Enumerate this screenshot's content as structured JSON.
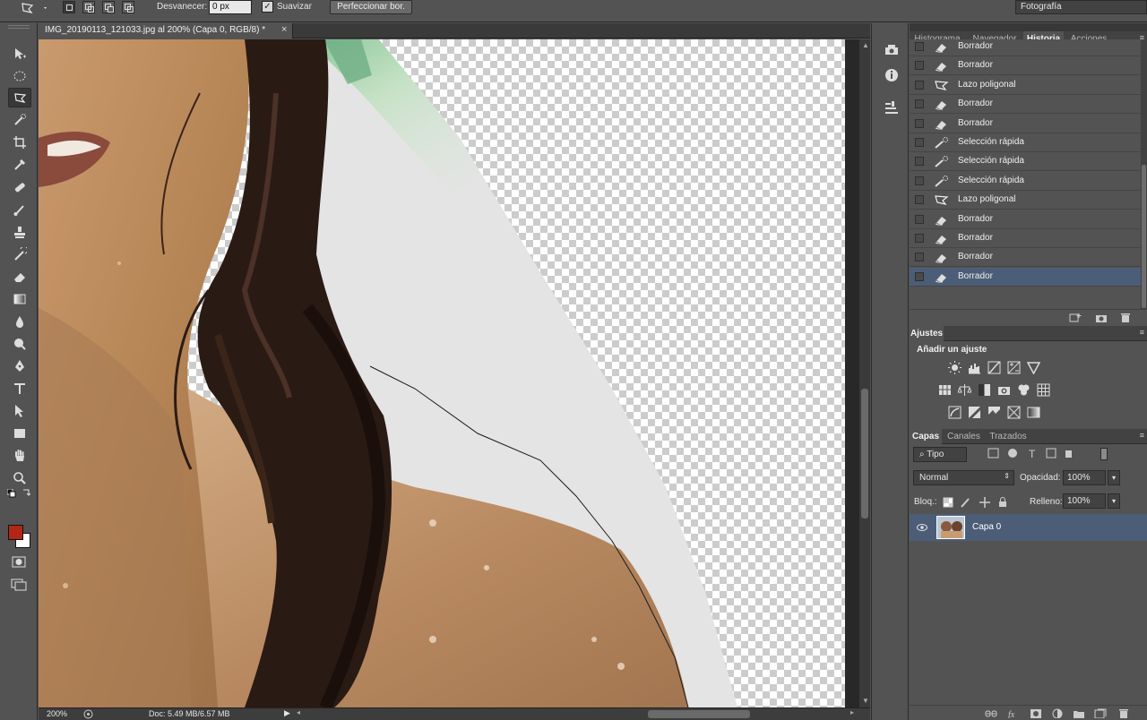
{
  "options_bar": {
    "feather_label": "Desvanecer:",
    "feather_value": "0 px",
    "antialias_label": "Suavizar",
    "antialias_checked": true,
    "refine_edge_label": "Perfeccionar bor.",
    "workspace": "Fotografía"
  },
  "toolbar": {
    "active_tool": "polygonal-lasso",
    "foreground_color": "#b22616",
    "background_color": "#ffffff"
  },
  "document": {
    "tab_title": "IMG_20190113_121033.jpg al 200% (Capa 0, RGB/8) *",
    "close_glyph": "×"
  },
  "status": {
    "zoom": "200%",
    "doc_size": "Doc: 5.49 MB/6.57 MB"
  },
  "history_panel": {
    "tabs": [
      "Histograma",
      "Navegador",
      "Historia",
      "Acciones"
    ],
    "active_tab": "Historia",
    "items": [
      {
        "label": "Borrador",
        "icon": "eraser-icon"
      },
      {
        "label": "Borrador",
        "icon": "eraser-icon"
      },
      {
        "label": "Lazo poligonal",
        "icon": "polygonal-lasso-icon"
      },
      {
        "label": "Borrador",
        "icon": "eraser-icon"
      },
      {
        "label": "Borrador",
        "icon": "eraser-icon"
      },
      {
        "label": "Selección rápida",
        "icon": "quick-selection-icon"
      },
      {
        "label": "Selección rápida",
        "icon": "quick-selection-icon"
      },
      {
        "label": "Selección rápida",
        "icon": "quick-selection-icon"
      },
      {
        "label": "Lazo poligonal",
        "icon": "polygonal-lasso-icon"
      },
      {
        "label": "Borrador",
        "icon": "eraser-icon"
      },
      {
        "label": "Borrador",
        "icon": "eraser-icon"
      },
      {
        "label": "Borrador",
        "icon": "eraser-icon"
      },
      {
        "label": "Borrador",
        "icon": "eraser-icon"
      }
    ],
    "selected_index": 12
  },
  "adjustments_panel": {
    "tab": "Ajustes",
    "title": "Añadir un ajuste"
  },
  "layers_panel": {
    "tabs": [
      "Capas",
      "Canales",
      "Trazados"
    ],
    "active_tab": "Capas",
    "filter_kind": "Tipo",
    "blend_mode": "Normal",
    "opacity_label": "Opacidad:",
    "opacity_value": "100%",
    "lock_label": "Bloq.:",
    "fill_label": "Relleno:",
    "fill_value": "100%",
    "layers": [
      {
        "name": "Capa 0",
        "visible": true,
        "selected": true
      }
    ]
  },
  "colors": {
    "ui_bg": "#535353",
    "selection_blue": "#4c5d77"
  }
}
